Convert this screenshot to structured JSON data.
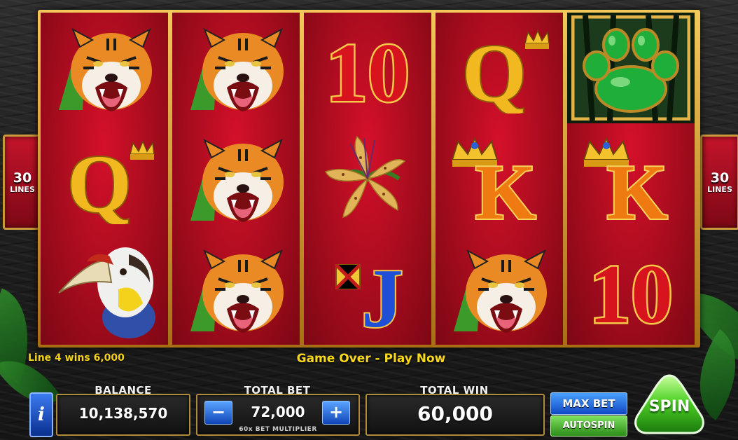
{
  "reels": [
    [
      "tiger",
      "queen",
      "hornbill"
    ],
    [
      "tiger",
      "tiger",
      "tiger"
    ],
    [
      "ten",
      "tiger-lily",
      "jack"
    ],
    [
      "queen",
      "king",
      "tiger"
    ],
    [
      "paw-scatter",
      "king",
      "ten"
    ]
  ],
  "symbol_text": {
    "ten": "10",
    "queen": "Q",
    "king": "K",
    "jack": "J"
  },
  "side_left": {
    "num": "30",
    "label": "LINES"
  },
  "side_right": {
    "num": "30",
    "label": "LINES"
  },
  "line_win": "Line 4 wins 6,000",
  "message": "Game Over - Play Now",
  "info_label": "i",
  "balance": {
    "label": "BALANCE",
    "value": "10,138,570"
  },
  "total_bet": {
    "label": "TOTAL BET",
    "value": "72,000",
    "minus": "−",
    "plus": "+",
    "multiplier": "60x BET MULTIPLIER"
  },
  "total_win": {
    "label": "TOTAL WIN",
    "value": "60,000"
  },
  "buttons": {
    "max_bet": "MAX BET",
    "autospin": "AUTOSPIN",
    "spin": "SPIN"
  },
  "colors": {
    "reel_red": "#c50e24",
    "gold": "#e7b53f",
    "spin_green": "#3fbf1f",
    "blue_btn": "#1f66e0"
  }
}
